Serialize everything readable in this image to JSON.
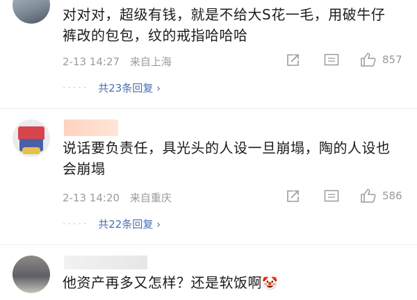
{
  "comments": [
    {
      "text": "对对对，超级有钱，就是不给大S花一毛，用破牛仔裤改的包包，纹的戒指哈哈哈",
      "date": "2-13 14:27",
      "location": "来自上海",
      "likes": "857",
      "replies_label": "共23条回复 ›"
    },
    {
      "text": "说话要负责任，具光头的人设一旦崩塌，陶的人设也会崩塌",
      "date": "2-13 14:20",
      "location": "来自重庆",
      "likes": "586",
      "replies_label": "共22条回复 ›"
    },
    {
      "text": "他资产再多又怎样？还是软饭啊",
      "emoji": "🤡"
    }
  ],
  "icons": [
    "share-icon",
    "comment-icon",
    "like-icon"
  ],
  "colors": {
    "link": "#4a6fb5",
    "meta": "#9b9b9b",
    "text": "#1b1b1b"
  }
}
